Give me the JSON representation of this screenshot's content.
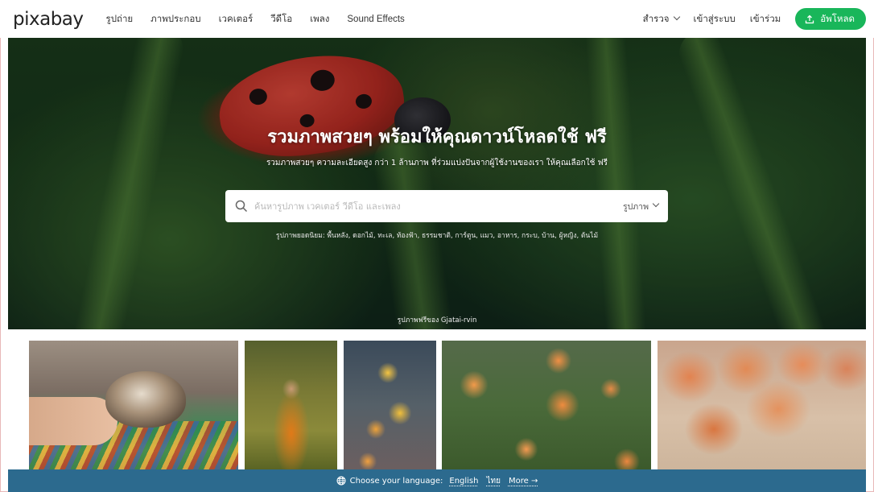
{
  "brand": {
    "logo_text": "pixabay"
  },
  "nav": {
    "left_items": [
      {
        "label": "รูปถ่าย"
      },
      {
        "label": "ภาพประกอบ"
      },
      {
        "label": "เวคเตอร์"
      },
      {
        "label": "วีดีโอ"
      },
      {
        "label": "เพลง"
      },
      {
        "label": "Sound Effects"
      }
    ],
    "explore_label": "สำรวจ",
    "login_label": "เข้าสู่ระบบ",
    "join_label": "เข้าร่วม",
    "upload_label": "อัพโหลด"
  },
  "hero": {
    "title": "รวมภาพสวยๆ พร้อมให้คุณดาวน์โหลดใช้ ฟรี",
    "subtitle": "รวมภาพสวยๆ ความละเอียดสูง กว่า 1 ล้านภาพ ที่ร่วมแบ่งปันจากผู้ใช้งานของเรา ให้คุณเลือกใช้ ฟรี",
    "search_placeholder": "ค้นหารูปภาพ เวคเตอร์ วีดีโอ และเพลง",
    "search_type": "รูปภาพ",
    "popular_text": "รูปภาพยอดนิยม: พื้นหลัง, ดอกไม้, ทะเล, ท้องฟ้า, ธรรมชาติ, การ์ตูน, แมว, อาหาร, กระบ, บ้าน, ผู้หญิง, ต้นไม้",
    "credit": "รูปภาพฟรีของ Gjatai-rvin"
  },
  "gallery": [
    {
      "name": "cat-photo"
    },
    {
      "name": "monk-photo"
    },
    {
      "name": "yellow-flowers-photo"
    },
    {
      "name": "orange-flowers-photo"
    },
    {
      "name": "eggs-photo"
    }
  ],
  "language_bar": {
    "label": "Choose your language:",
    "languages": [
      "English",
      "ไทย"
    ],
    "more": "More →"
  },
  "colors": {
    "upload_button": "#19b65a",
    "language_bar": "#2c6a8e"
  }
}
